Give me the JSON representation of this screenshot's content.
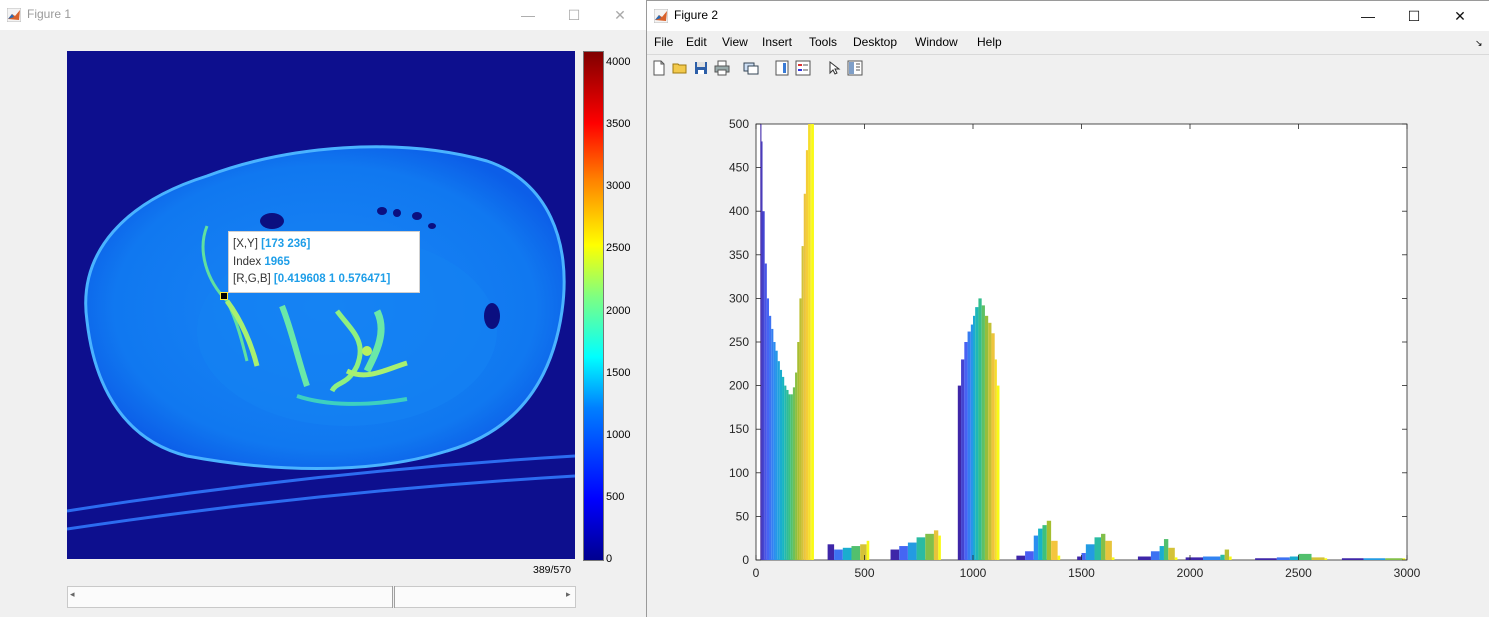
{
  "figure1": {
    "title": "Figure 1",
    "controls": {
      "minimize": "—",
      "maximize": "☐",
      "close": "✕"
    },
    "datatip": {
      "xy_label": "[X,Y]",
      "xy_value": "[173 236]",
      "index_label": "Index",
      "index_value": "1965",
      "rgb_label": "[R,G,B]",
      "rgb_value": "[0.419608 1 0.576471]"
    },
    "colorbar_ticks": [
      "4000",
      "3500",
      "3000",
      "2500",
      "2000",
      "1500",
      "1000",
      "500",
      "0"
    ],
    "slice_label": "389/570",
    "slider": {
      "position_fraction": 0.64
    }
  },
  "figure2": {
    "title": "Figure 2",
    "controls": {
      "minimize": "—",
      "maximize": "☐",
      "close": "✕"
    },
    "menu": [
      "File",
      "Edit",
      "View",
      "Insert",
      "Tools",
      "Desktop",
      "Window",
      "Help"
    ],
    "toolbar_icons": [
      "new-figure-icon",
      "open-file-icon",
      "save-icon",
      "print-icon",
      "link-plot-icon",
      "insert-colorbar-icon",
      "insert-legend-icon",
      "edit-plot-arrow-icon",
      "property-inspector-icon"
    ]
  },
  "chart_data": {
    "type": "bar",
    "title": "",
    "xlabel": "",
    "ylabel": "",
    "xlim": [
      0,
      3000
    ],
    "ylim": [
      0,
      500
    ],
    "xticks": [
      0,
      500,
      1000,
      1500,
      2000,
      2500,
      3000
    ],
    "yticks": [
      0,
      50,
      100,
      150,
      200,
      250,
      300,
      350,
      400,
      450,
      500
    ],
    "colormap": [
      "#3e26a8",
      "#4a5ef3",
      "#2a8ff0",
      "#16b4c7",
      "#3dc17c",
      "#a5be30",
      "#f4c53e",
      "#f9fb15"
    ],
    "series": [
      {
        "x": [
          20,
          25,
          30,
          40,
          50,
          60,
          70,
          80,
          90,
          100,
          110,
          120,
          130,
          140,
          150,
          160,
          170,
          180,
          190,
          200,
          210,
          220,
          230,
          240,
          250,
          255
        ],
        "values": [
          500,
          480,
          400,
          340,
          300,
          280,
          265,
          250,
          240,
          228,
          218,
          210,
          200,
          195,
          190,
          190,
          198,
          215,
          250,
          300,
          360,
          420,
          470,
          500,
          500,
          500
        ]
      },
      {
        "x": [
          330,
          360,
          400,
          440,
          480,
          510
        ],
        "values": [
          18,
          12,
          14,
          16,
          18,
          22
        ]
      },
      {
        "x": [
          620,
          660,
          700,
          740,
          780,
          820,
          840
        ],
        "values": [
          12,
          16,
          20,
          26,
          30,
          34,
          28
        ]
      },
      {
        "x": [
          930,
          945,
          960,
          975,
          990,
          1000,
          1010,
          1025,
          1040,
          1055,
          1070,
          1085,
          1100,
          1110
        ],
        "values": [
          200,
          230,
          250,
          262,
          270,
          280,
          290,
          300,
          292,
          280,
          272,
          260,
          230,
          200
        ]
      },
      {
        "x": [
          1200,
          1240,
          1280,
          1300,
          1320,
          1340,
          1360,
          1390
        ],
        "values": [
          5,
          10,
          28,
          36,
          40,
          45,
          22,
          5
        ]
      },
      {
        "x": [
          1480,
          1500,
          1520,
          1560,
          1590,
          1610,
          1640
        ],
        "values": [
          4,
          8,
          18,
          26,
          30,
          22,
          3
        ]
      },
      {
        "x": [
          1760,
          1820,
          1860,
          1880,
          1900,
          1930
        ],
        "values": [
          4,
          10,
          16,
          24,
          14,
          3
        ]
      },
      {
        "x": [
          1980,
          2060,
          2140,
          2160,
          2180
        ],
        "values": [
          3,
          4,
          6,
          12,
          4
        ]
      },
      {
        "x": [
          2300,
          2400,
          2460,
          2500,
          2560,
          2620
        ],
        "values": [
          2,
          3,
          4,
          7,
          3,
          2
        ]
      },
      {
        "x": [
          2700,
          2800,
          2900,
          2980
        ],
        "values": [
          2,
          2,
          2,
          2
        ]
      }
    ]
  }
}
